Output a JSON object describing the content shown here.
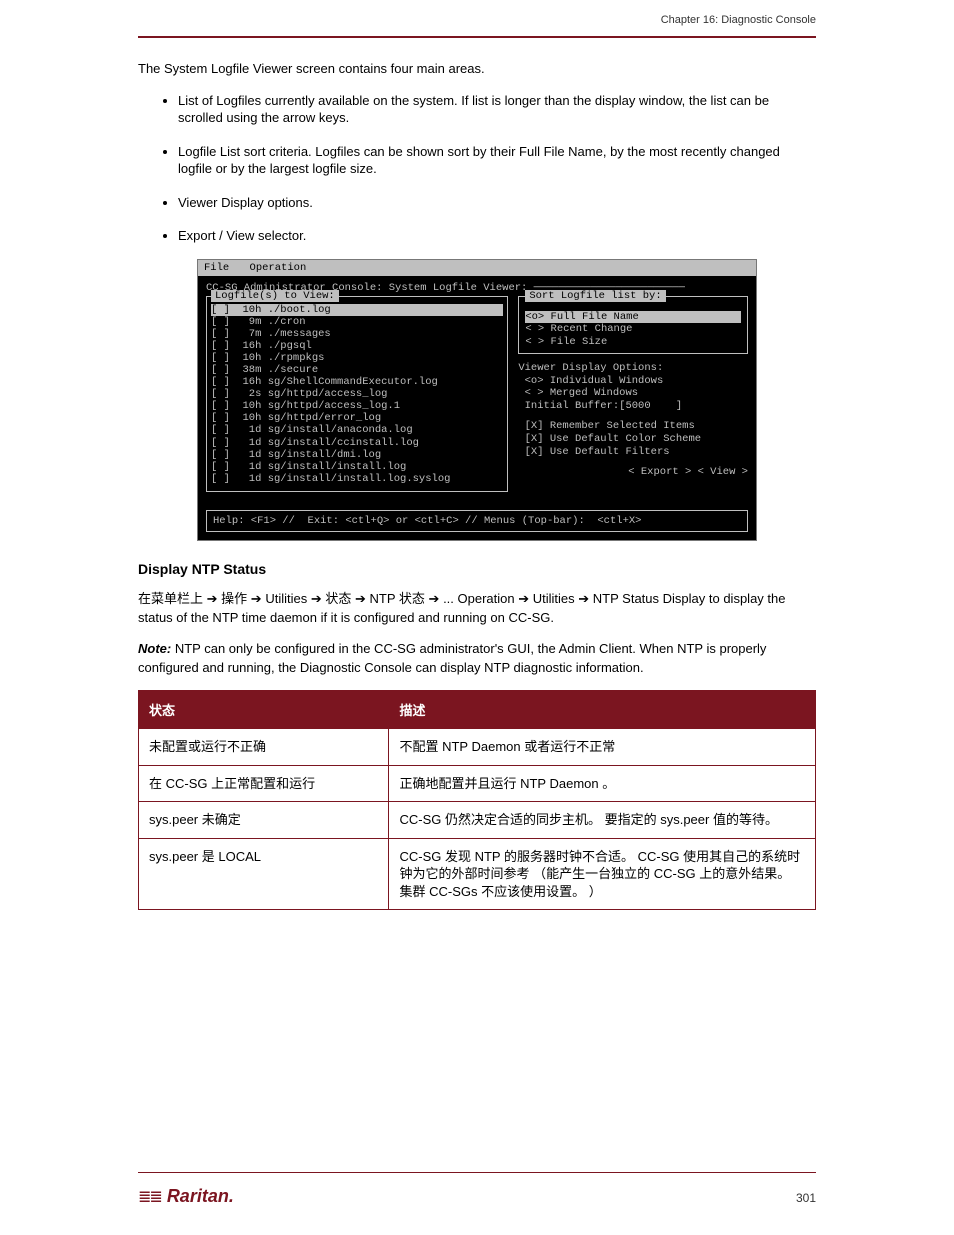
{
  "header": {
    "chapter": "Chapter 16: Diagnostic Console"
  },
  "body": {
    "intro": "The System Logfile Viewer screen contains four main areas.",
    "bullets": [
      "List of Logfiles currently available on the system. If list is longer than the display window, the list can be scrolled using the arrow keys.",
      "Logfile List sort criteria. Logfiles can be shown sort by their Full File Name, by the most recently changed logfile or by the largest logfile size.",
      "Viewer Display options.",
      "Export / View selector."
    ]
  },
  "screenshot": {
    "menu": [
      "File",
      "Operation"
    ],
    "title_line": "CC-SG Administrator Console: System Logfile Viewer: ────────────────────────",
    "left_legend": " Logfile(s) to View: ",
    "log_rows": [
      "[ ]  10h ./boot.log",
      "[ ]   9m ./cron",
      "[ ]   7m ./messages",
      "[ ]  16h ./pgsql",
      "[ ]  10h ./rpmpkgs",
      "[ ]  38m ./secure",
      "[ ]  16h sg/ShellCommandExecutor.log",
      "[ ]   2s sg/httpd/access_log",
      "[ ]  10h sg/httpd/access_log.1",
      "[ ]  10h sg/httpd/error_log",
      "[ ]   1d sg/install/anaconda.log",
      "[ ]   1d sg/install/ccinstall.log",
      "[ ]   1d sg/install/dmi.log",
      "[ ]   1d sg/install/install.log",
      "[ ]   1d sg/install/install.log.syslog"
    ],
    "sort_legend": " Sort Logfile list by: ",
    "sort_opts": [
      "<o> Full File Name",
      "< > Recent Change",
      "< > File Size"
    ],
    "disp_title": "Viewer Display Options:",
    "disp_opts": [
      " <o> Individual Windows",
      " < > Merged Windows",
      " Initial Buffer:[5000    ]"
    ],
    "checks": [
      " [X] Remember Selected Items",
      " [X] Use Default Color Scheme",
      " [X] Use Default Filters"
    ],
    "buttons": "< Export > < View >",
    "help_line": "Help: <F1> //  Exit: <ctl+Q> or <ctl+C> // Menus (Top-bar):  <ctl+X>"
  },
  "ntp": {
    "heading": "Display NTP Status",
    "p1_a": "在菜单栏上",
    "p1_b": " 操作 ",
    "p1_c": " Utilities ",
    "p1_d": " 状态 ",
    "p1_e": " NTP 状态 ",
    "p1_f": "... Operation ",
    "p1_g": " Utilities ",
    "p1_h": " NTP Status Display to display the status of the NTP time daemon if it is configured and running on CC-SG.",
    "note_label": "Note:",
    "note_text": " NTP can only be configured in the CC-SG administrator's GUI, the Admin Client. When NTP is properly configured and running, the Diagnostic Console can display NTP diagnostic information.",
    "table": {
      "headers": [
        "状态",
        "描述"
      ],
      "rows": [
        [
          "未配置或运行不正确",
          "不配置 NTP Daemon 或者运行不正常"
        ],
        [
          "在 CC-SG 上正常配置和运行",
          "正确地配置并且运行 NTP Daemon 。"
        ],
        [
          "sys.peer 未确定",
          "CC-SG 仍然决定合适的同步主机。  要指定的 sys.peer 值的等待。"
        ],
        [
          "sys.peer 是 LOCAL",
          "CC-SG 发现 NTP 的服务器时钟不合适。 CC-SG 使用其自己的系统时钟为它的外部时间参考 （能产生一台独立的 CC-SG 上的意外结果。 集群 CC-SGs 不应该使用设置。 ）"
        ]
      ]
    }
  },
  "footer": {
    "brand": "Raritan.",
    "page": "301"
  }
}
